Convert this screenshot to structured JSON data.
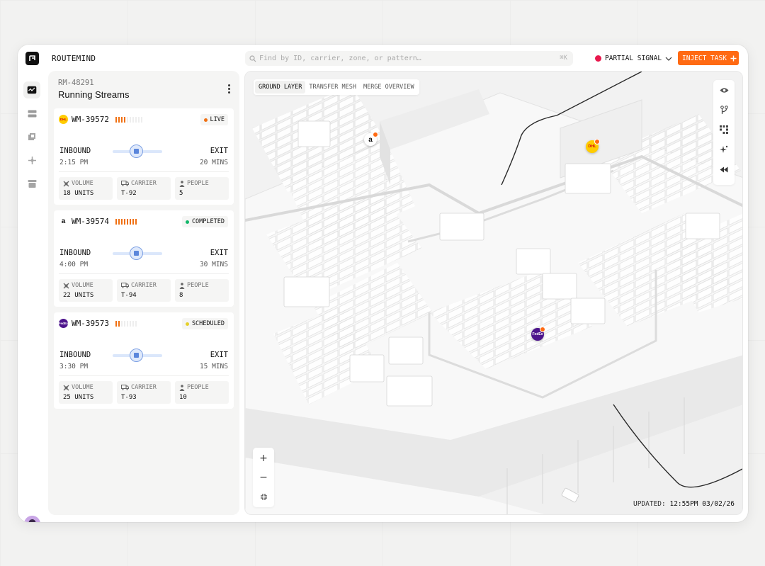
{
  "app": {
    "title": "ROUTEMIND"
  },
  "search": {
    "placeholder": "Find by ID, carrier, zone, or pattern…",
    "shortcut": "⌘K"
  },
  "signal": {
    "label": "PARTIAL SIGNAL",
    "color": "#e8184d"
  },
  "inject": {
    "label": "INJECT TASK"
  },
  "rail": {
    "items": [
      "activity-icon",
      "stack-icon",
      "layers-icon",
      "network-icon",
      "archive-icon"
    ],
    "active": 0
  },
  "panel": {
    "id": "RM-48291",
    "title": "Running Streams",
    "cards": [
      {
        "id": "WM-39572",
        "brand": "DHL",
        "brand_color": "#ffcc00",
        "signal_level": 4,
        "signal_total": 10,
        "status": "LIVE",
        "status_color": "#f07012",
        "flow_left": "INBOUND",
        "time": "2:15 PM",
        "flow_right": "EXIT",
        "duration": "20 MINS",
        "metrics": [
          {
            "label": "VOLUME",
            "value": "18 UNITS"
          },
          {
            "label": "CARRIER",
            "value": "T-92"
          },
          {
            "label": "PEOPLE",
            "value": "5"
          }
        ]
      },
      {
        "id": "WM-39574",
        "brand": "a",
        "brand_color": "#ffffff",
        "signal_level": 8,
        "signal_total": 8,
        "status": "COMPLETED",
        "status_color": "#12b76a",
        "flow_left": "INBOUND",
        "time": "4:00 PM",
        "flow_right": "EXIT",
        "duration": "30 MINS",
        "metrics": [
          {
            "label": "VOLUME",
            "value": "22 UNITS"
          },
          {
            "label": "CARRIER",
            "value": "T-94"
          },
          {
            "label": "PEOPLE",
            "value": "8"
          }
        ]
      },
      {
        "id": "WM-39573",
        "brand": "FedEx",
        "brand_color": "#4d148c",
        "signal_level": 2,
        "signal_total": 8,
        "status": "SCHEDULED",
        "status_color": "#e5d02a",
        "flow_left": "INBOUND",
        "time": "3:30 PM",
        "flow_right": "EXIT",
        "duration": "15 MINS",
        "metrics": [
          {
            "label": "VOLUME",
            "value": "25 UNITS"
          },
          {
            "label": "CARRIER",
            "value": "T-93"
          },
          {
            "label": "PEOPLE",
            "value": "10"
          }
        ]
      }
    ]
  },
  "map": {
    "tabs": [
      "GROUND LAYER",
      "TRANSFER MESH",
      "MERGE OVERVIEW"
    ],
    "active_tab": 0,
    "tools": [
      "eye-icon",
      "branch-icon",
      "grid-icon",
      "sparkle-icon",
      "rewind-icon"
    ],
    "zoom": {
      "in": "+",
      "out": "−"
    },
    "updated_label": "UPDATED:",
    "updated_value": "12:55PM 03/02/26",
    "pins": [
      {
        "brand": "amazon",
        "text": "a"
      },
      {
        "brand": "dhl",
        "text": "DHL"
      },
      {
        "brand": "fedex",
        "text": "FedEx"
      }
    ]
  }
}
